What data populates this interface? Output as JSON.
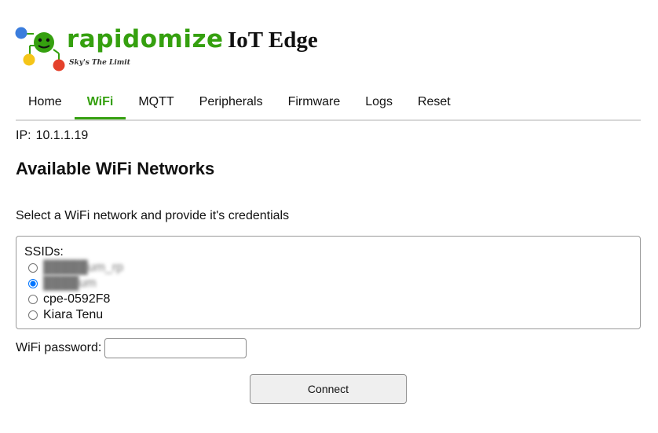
{
  "header": {
    "brand": "rapidomize",
    "tagline": "Sky's The Limit",
    "app_title": "IoT Edge"
  },
  "nav": {
    "items": [
      {
        "label": "Home",
        "active": false
      },
      {
        "label": "WiFi",
        "active": true
      },
      {
        "label": "MQTT",
        "active": false
      },
      {
        "label": "Peripherals",
        "active": false
      },
      {
        "label": "Firmware",
        "active": false
      },
      {
        "label": "Logs",
        "active": false
      },
      {
        "label": "Reset",
        "active": false
      }
    ]
  },
  "ip": {
    "label": "IP:",
    "value": "10.1.1.19"
  },
  "page_title": "Available WiFi Networks",
  "instructions": "Select a WiFi network and provide it's credentials",
  "ssids": {
    "legend": "SSIDs:",
    "options": [
      {
        "label": "█████um_rp",
        "selected": false,
        "blurred": true
      },
      {
        "label": "████um",
        "selected": true,
        "blurred": true
      },
      {
        "label": "cpe-0592F8",
        "selected": false,
        "blurred": false
      },
      {
        "label": "Kiara Tenu",
        "selected": false,
        "blurred": false
      }
    ]
  },
  "password": {
    "label": "WiFi password:",
    "value": "",
    "placeholder": ""
  },
  "connect_label": "Connect",
  "colors": {
    "brand_green": "#35a00f",
    "dot_blue": "#3b7ddd",
    "dot_yellow": "#f5c518",
    "dot_red": "#e4412b"
  }
}
